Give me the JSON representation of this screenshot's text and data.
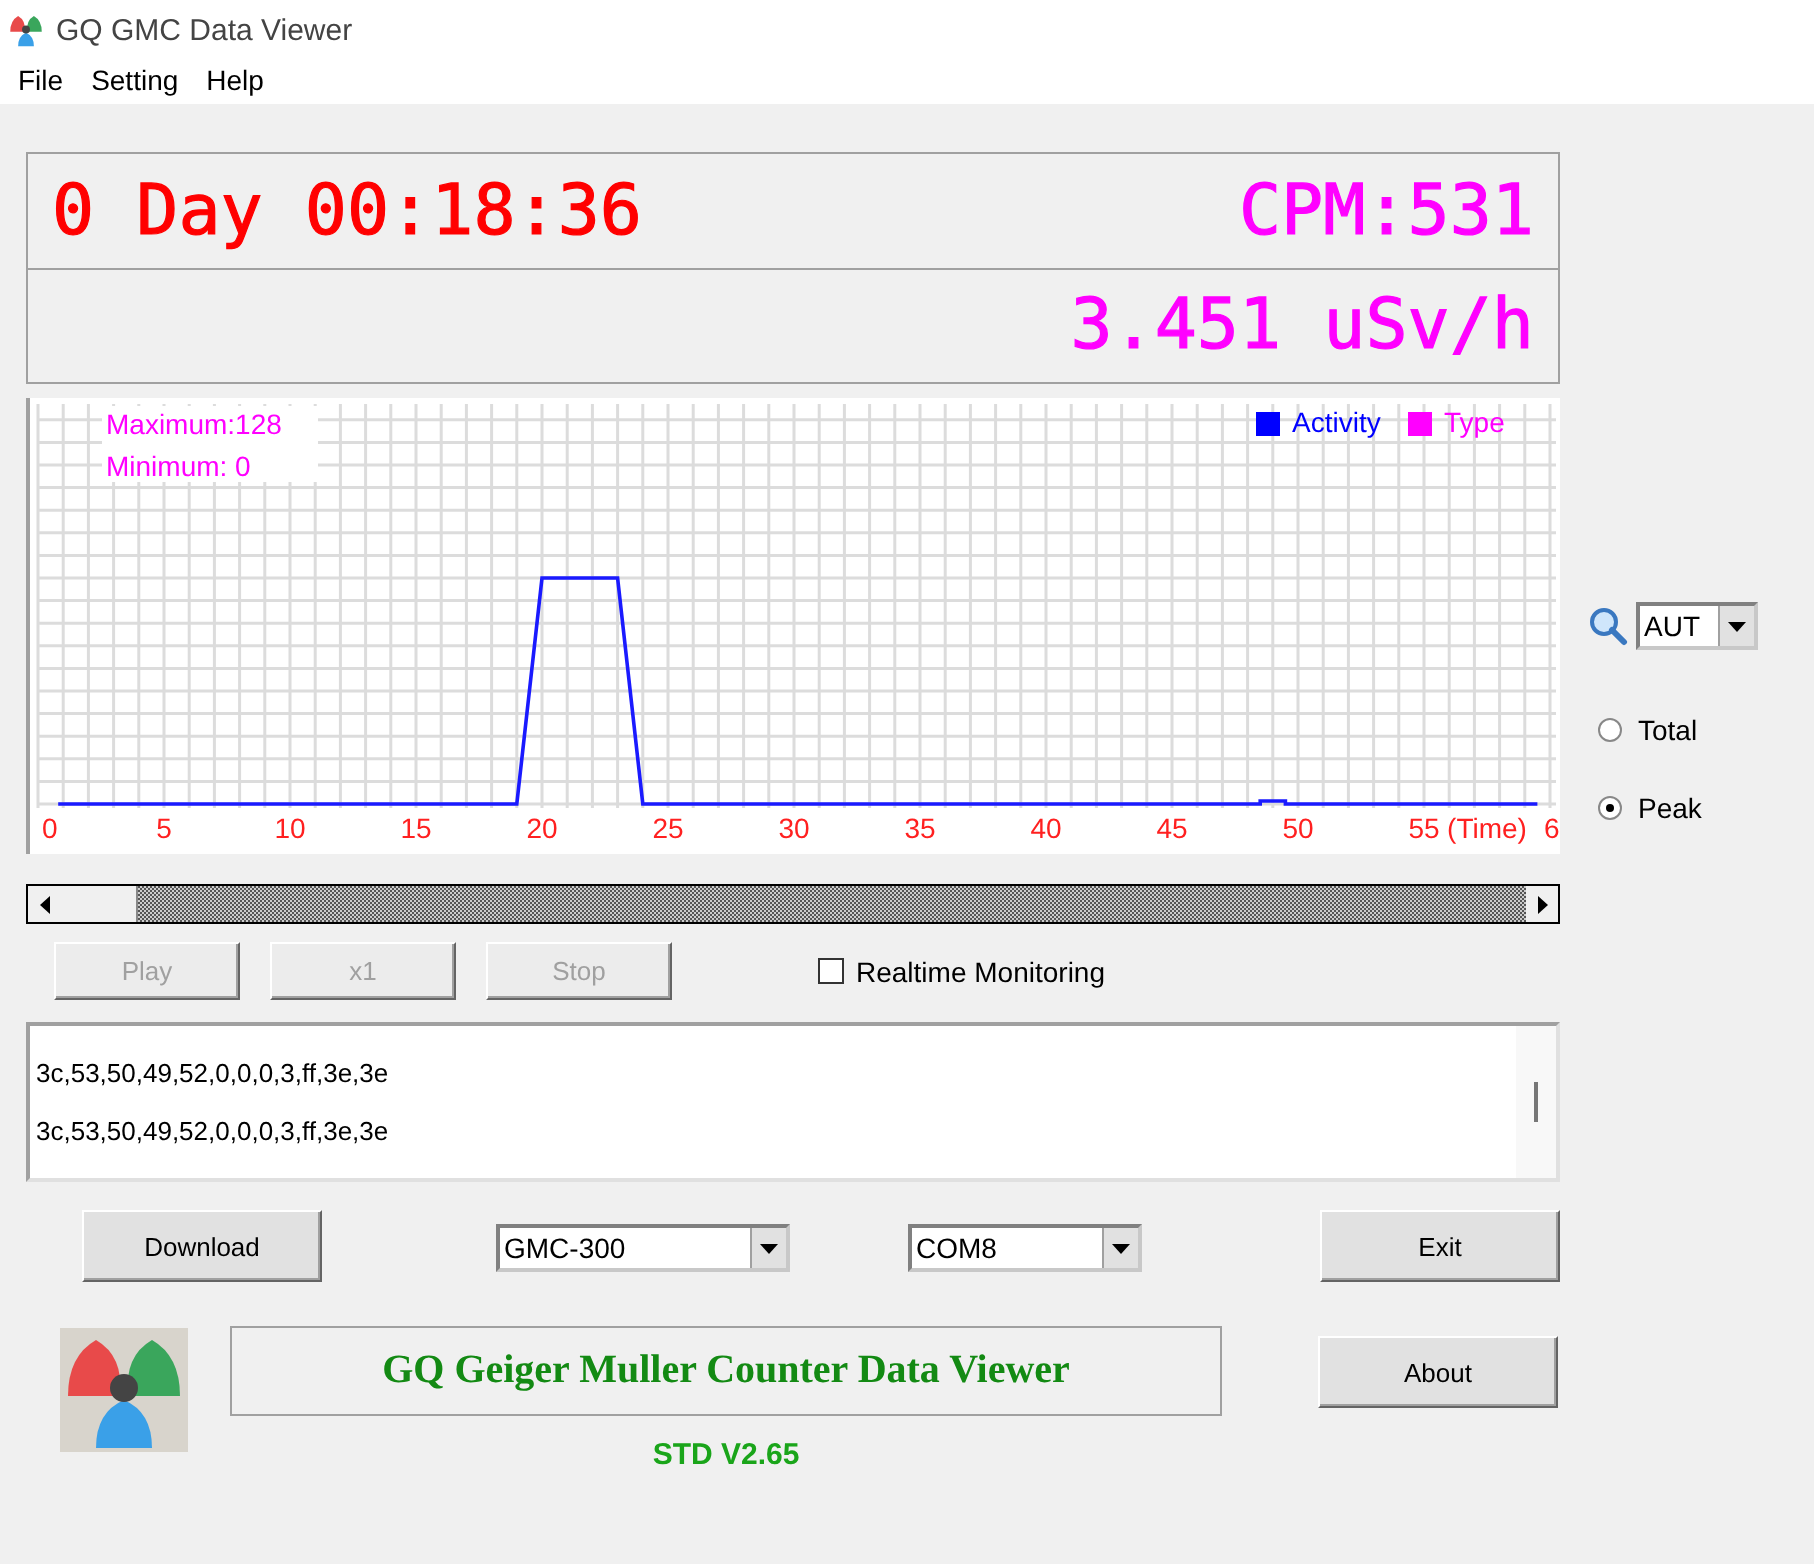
{
  "window": {
    "title": "GQ GMC Data Viewer"
  },
  "menu": [
    {
      "label": "File"
    },
    {
      "label": "Setting"
    },
    {
      "label": "Help"
    }
  ],
  "readout": {
    "elapsed": "0 Day 00:18:36",
    "cpm": "CPM:531",
    "dose_rate": "3.451 uSv/h"
  },
  "chart": {
    "maximum": "Maximum:128",
    "minimum": "Minimum: 0",
    "legend": [
      {
        "label": "Activity",
        "color": "#0000ff"
      },
      {
        "label": "Type",
        "color": "#ff00ff"
      }
    ],
    "x_labels": [
      "0",
      "5",
      "10",
      "15",
      "20",
      "25",
      "30",
      "35",
      "40",
      "45",
      "50",
      "55"
    ],
    "x_title": "(Time)",
    "x_last": "6"
  },
  "zoom": {
    "value": "AUT"
  },
  "view_mode": [
    {
      "label": "Total",
      "selected": false
    },
    {
      "label": "Peak",
      "selected": true
    }
  ],
  "playback": [
    {
      "label": "Play",
      "disabled": true
    },
    {
      "label": "x1",
      "disabled": true
    },
    {
      "label": "Stop",
      "disabled": true
    }
  ],
  "realtime": {
    "label": "Realtime Monitoring",
    "checked": false
  },
  "log": [
    "3c,53,50,49,52,0,0,0,3,ff,3e,3e",
    "3c,53,50,49,52,0,0,0,3,ff,3e,3e"
  ],
  "download_button": "Download",
  "model": {
    "value": "GMC-300"
  },
  "port": {
    "value": "COM8"
  },
  "exit_button": "Exit",
  "about_button": "About",
  "banner": "GQ Geiger Muller Counter Data Viewer",
  "version": "STD V2.65"
}
